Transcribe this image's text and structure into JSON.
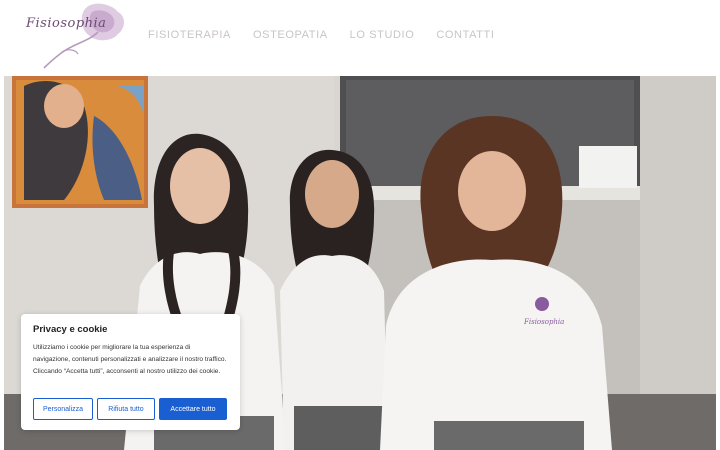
{
  "logo": {
    "text": "Fisiosophia"
  },
  "nav": {
    "items": [
      {
        "label": "FISIOTERAPIA"
      },
      {
        "label": "OSTEOPATIA"
      },
      {
        "label": "LO STUDIO"
      },
      {
        "label": "CONTATTI"
      }
    ]
  },
  "hero": {
    "shirt_logo": "Fisiosophia"
  },
  "cookie": {
    "title": "Privacy e cookie",
    "text": "Utilizziamo i cookie per migliorare la tua esperienza di navigazione, contenuti personalizzati e analizzare il nostro traffico. Cliccando “Accetta tutti”, acconsenti al nostro utilizzo dei cookie.",
    "customize_label": "Personalizza",
    "reject_label": "Rifiuta tutto",
    "accept_label": "Accettare tutto"
  },
  "colors": {
    "accent": "#1a5fd1",
    "nav_text": "#c9c4c9",
    "brand_purple": "#a98bb5"
  }
}
